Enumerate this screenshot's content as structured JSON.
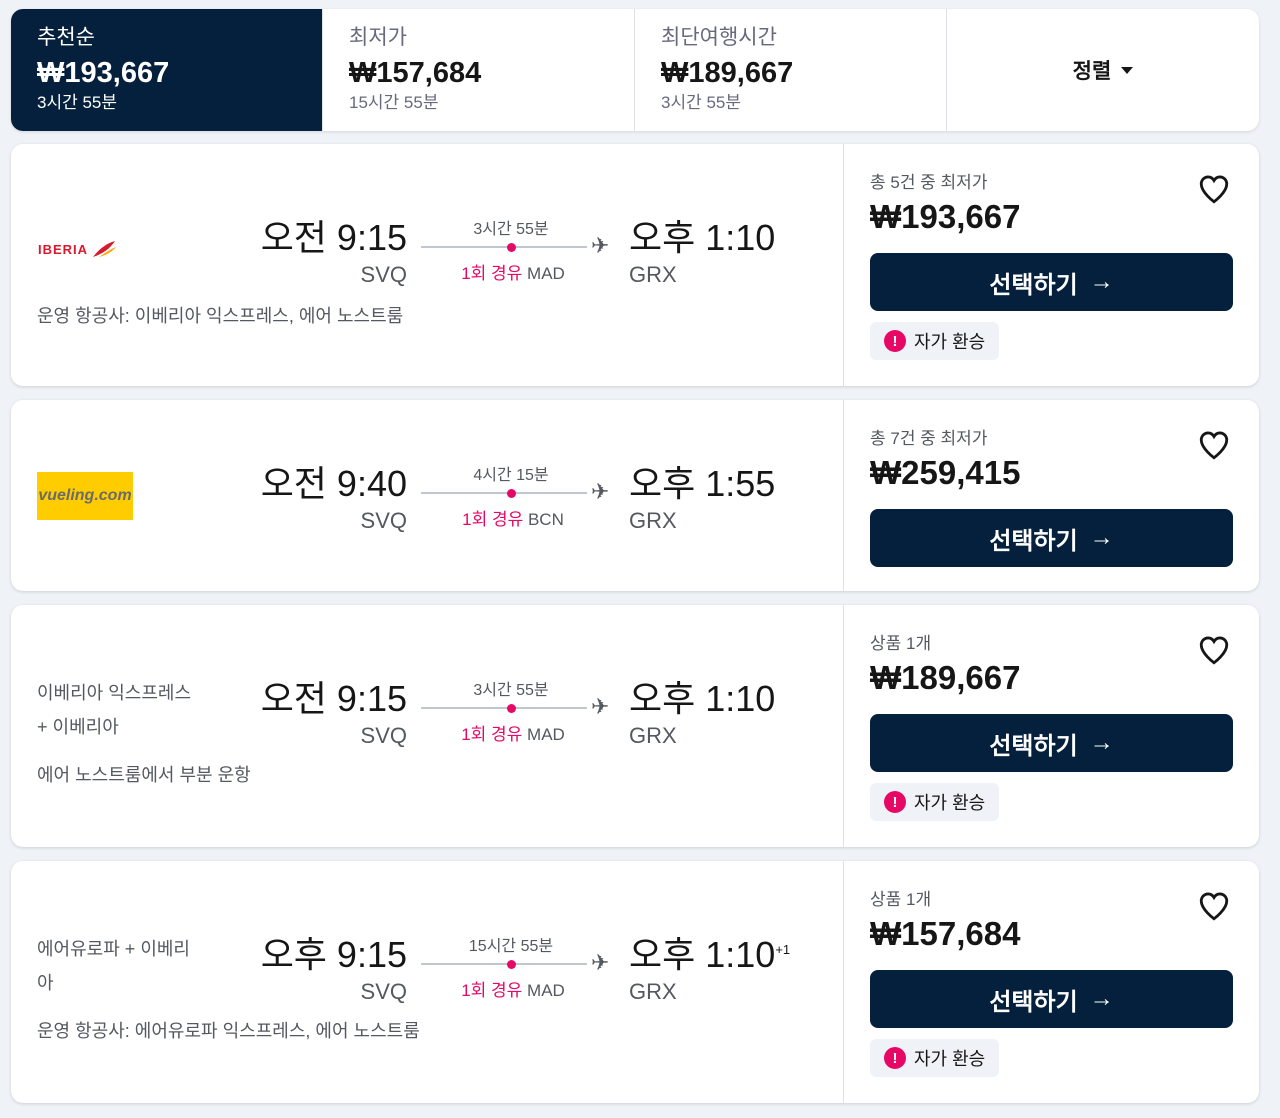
{
  "tabs": [
    {
      "title": "추천순",
      "price": "₩193,667",
      "duration": "3시간 55분"
    },
    {
      "title": "최저가",
      "price": "₩157,684",
      "duration": "15시간 55분"
    },
    {
      "title": "최단여행시간",
      "price": "₩189,667",
      "duration": "3시간 55분"
    }
  ],
  "sort": {
    "label": "정렬"
  },
  "colors": {
    "accent_navy": "#05203c",
    "stop_pink": "#e70866",
    "vueling_yellow": "#ffcc00",
    "iberia_red": "#d7192d"
  },
  "results": [
    {
      "airline_logo": "IBERIA",
      "operated_by": "운영 항공사: 이베리아 익스프레스, 에어 노스트룸",
      "dep_time": "오전 9:15",
      "dep_code": "SVQ",
      "duration": "3시간 55분",
      "stops": "1회 경유",
      "via": "MAD",
      "arr_time": "오후 1:10",
      "arr_code": "GRX",
      "offer_count": "총 5건 중 최저가",
      "price": "₩193,667",
      "select_label": "선택하기",
      "self_transfer": "자가 환승"
    },
    {
      "airline_logo": "vueling.com",
      "dep_time": "오전 9:40",
      "dep_code": "SVQ",
      "duration": "4시간 15분",
      "stops": "1회 경유",
      "via": "BCN",
      "arr_time": "오후 1:55",
      "arr_code": "GRX",
      "offer_count": "총 7건 중 최저가",
      "price": "₩259,415",
      "select_label": "선택하기"
    },
    {
      "airline_line1": "이베리아 익스프레스",
      "airline_line2": "+ 이베리아",
      "operated_by": "에어 노스트룸에서 부분 운항",
      "dep_time": "오전 9:15",
      "dep_code": "SVQ",
      "duration": "3시간 55분",
      "stops": "1회 경유",
      "via": "MAD",
      "arr_time": "오후 1:10",
      "arr_code": "GRX",
      "offer_count": "상품 1개",
      "price": "₩189,667",
      "select_label": "선택하기",
      "self_transfer": "자가 환승"
    },
    {
      "airline_line1": "에어유로파 + 이베리",
      "airline_line2": "아",
      "operated_by": "운영 항공사: 에어유로파 익스프레스, 에어 노스트룸",
      "dep_time": "오후 9:15",
      "dep_code": "SVQ",
      "duration": "15시간 55분",
      "stops": "1회 경유",
      "via": "MAD",
      "arr_time": "오후 1:10",
      "arr_day_offset": "+1",
      "arr_code": "GRX",
      "offer_count": "상품 1개",
      "price": "₩157,684",
      "select_label": "선택하기",
      "self_transfer": "자가 환승"
    }
  ]
}
